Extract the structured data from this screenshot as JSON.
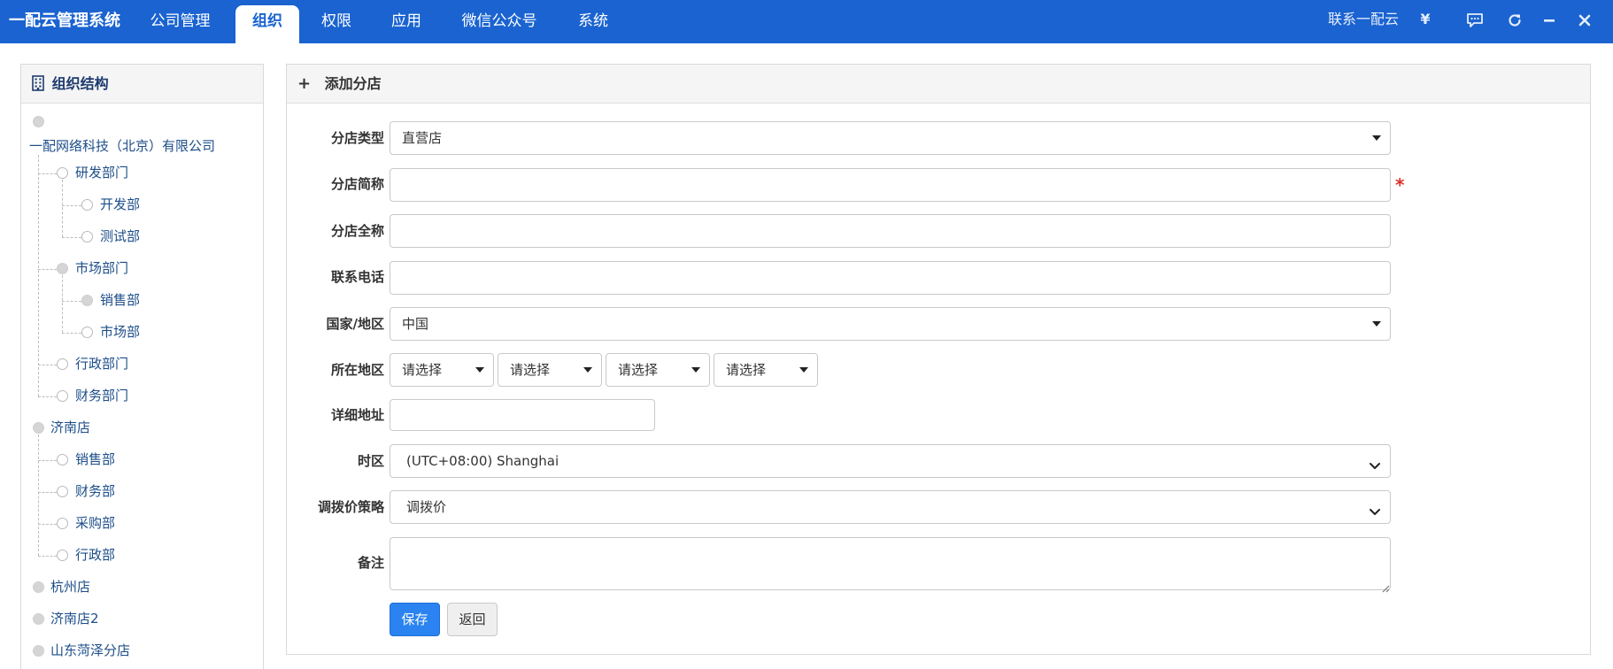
{
  "app": {
    "brand": "一配云管理系统"
  },
  "nav": {
    "tabs": [
      {
        "label": "公司管理"
      },
      {
        "label": "组织"
      },
      {
        "label": "权限"
      },
      {
        "label": "应用"
      },
      {
        "label": "微信公众号"
      },
      {
        "label": "系统"
      }
    ],
    "active_index": 1
  },
  "topright": {
    "contact": "联系一配云",
    "currency": "¥",
    "icons": [
      "chat-icon",
      "refresh-icon",
      "minimize-icon",
      "close-icon"
    ]
  },
  "left": {
    "title": "组织结构",
    "icon": "building-icon",
    "tree": [
      {
        "label": "一配网络科技（北京）有限公司",
        "level": 0,
        "dot": "filled"
      },
      {
        "label": "研发部门",
        "level": 1,
        "dot": "hollow"
      },
      {
        "label": "开发部",
        "level": 2,
        "dot": "hollow"
      },
      {
        "label": "测试部",
        "level": 2,
        "dot": "hollow"
      },
      {
        "label": "市场部门",
        "level": 1,
        "dot": "filled"
      },
      {
        "label": "销售部",
        "level": 2,
        "dot": "filled"
      },
      {
        "label": "市场部",
        "level": 2,
        "dot": "hollow"
      },
      {
        "label": "行政部门",
        "level": 1,
        "dot": "hollow"
      },
      {
        "label": "财务部门",
        "level": 1,
        "dot": "hollow"
      },
      {
        "label": "济南店",
        "level": 0,
        "dot": "filled"
      },
      {
        "label": "销售部",
        "level": 1,
        "dot": "hollow"
      },
      {
        "label": "财务部",
        "level": 1,
        "dot": "hollow"
      },
      {
        "label": "采购部",
        "level": 1,
        "dot": "hollow"
      },
      {
        "label": "行政部",
        "level": 1,
        "dot": "hollow"
      },
      {
        "label": "杭州店",
        "level": 0,
        "dot": "filled"
      },
      {
        "label": "济南店2",
        "level": 0,
        "dot": "filled"
      },
      {
        "label": "山东菏泽分店",
        "level": 0,
        "dot": "filled"
      }
    ]
  },
  "form": {
    "title": "添加分店",
    "labels": {
      "type": "分店类型",
      "short_name": "分店简称",
      "full_name": "分店全称",
      "phone": "联系电话",
      "country": "国家/地区",
      "region": "所在地区",
      "address": "详细地址",
      "timezone": "时区",
      "pricing": "调拨价策略",
      "notes": "备注"
    },
    "values": {
      "type": "直营店",
      "short_name": "",
      "full_name": "",
      "phone": "",
      "country": "中国",
      "region": [
        "请选择",
        "请选择",
        "请选择",
        "请选择"
      ],
      "address": "",
      "timezone": "(UTC+08:00) Shanghai",
      "pricing": "调拨价",
      "notes": ""
    },
    "required_mark": "*",
    "buttons": {
      "save": "保存",
      "back": "返回"
    }
  },
  "colors": {
    "topbar": "#1a63d1",
    "primary": "#2a83f0",
    "required": "#d9302a"
  }
}
